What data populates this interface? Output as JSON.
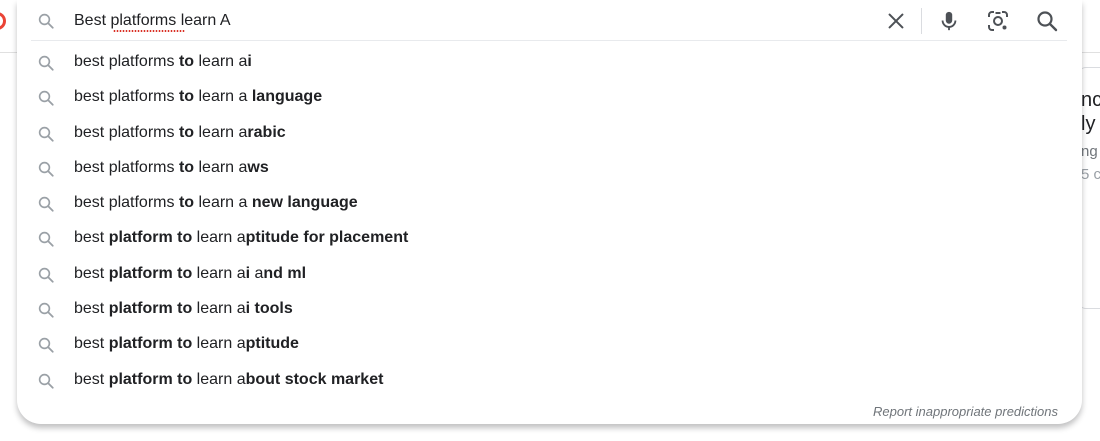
{
  "search": {
    "query": "Best platforms learn A",
    "clear_label": "Clear",
    "voice_label": "Search by voice",
    "lens_label": "Search by image",
    "submit_label": "Search"
  },
  "suggestions": [
    {
      "segments": [
        {
          "t": "best platforms ",
          "b": false
        },
        {
          "t": "to",
          "b": true
        },
        {
          "t": " learn a",
          "b": false
        },
        {
          "t": "i",
          "b": true
        }
      ]
    },
    {
      "segments": [
        {
          "t": "best platforms ",
          "b": false
        },
        {
          "t": "to",
          "b": true
        },
        {
          "t": " learn a ",
          "b": false
        },
        {
          "t": "language",
          "b": true
        }
      ]
    },
    {
      "segments": [
        {
          "t": "best platforms ",
          "b": false
        },
        {
          "t": "to",
          "b": true
        },
        {
          "t": " learn a",
          "b": false
        },
        {
          "t": "rabic",
          "b": true
        }
      ]
    },
    {
      "segments": [
        {
          "t": "best platforms ",
          "b": false
        },
        {
          "t": "to",
          "b": true
        },
        {
          "t": " learn a",
          "b": false
        },
        {
          "t": "ws",
          "b": true
        }
      ]
    },
    {
      "segments": [
        {
          "t": "best platforms ",
          "b": false
        },
        {
          "t": "to",
          "b": true
        },
        {
          "t": " learn a ",
          "b": false
        },
        {
          "t": "new language",
          "b": true
        }
      ]
    },
    {
      "segments": [
        {
          "t": "best ",
          "b": false
        },
        {
          "t": "platform to",
          "b": true
        },
        {
          "t": " learn a",
          "b": false
        },
        {
          "t": "ptitude for placement",
          "b": true
        }
      ]
    },
    {
      "segments": [
        {
          "t": "best ",
          "b": false
        },
        {
          "t": "platform to",
          "b": true
        },
        {
          "t": " learn a",
          "b": false
        },
        {
          "t": "i",
          "b": true
        },
        {
          "t": " a",
          "b": false
        },
        {
          "t": "nd ml",
          "b": true
        }
      ]
    },
    {
      "segments": [
        {
          "t": "best ",
          "b": false
        },
        {
          "t": "platform to",
          "b": true
        },
        {
          "t": " learn a",
          "b": false
        },
        {
          "t": "i tools",
          "b": true
        }
      ]
    },
    {
      "segments": [
        {
          "t": "best ",
          "b": false
        },
        {
          "t": "platform to",
          "b": true
        },
        {
          "t": " learn a",
          "b": false
        },
        {
          "t": "ptitude",
          "b": true
        }
      ]
    },
    {
      "segments": [
        {
          "t": "best ",
          "b": false
        },
        {
          "t": "platform to",
          "b": true
        },
        {
          "t": " learn a",
          "b": false
        },
        {
          "t": "bout stock market",
          "b": true
        }
      ]
    }
  ],
  "report_link": "Report inappropriate predictions",
  "background_card": {
    "line1": "nc",
    "line2": "ly",
    "line3": "ng",
    "line4": "5 c"
  },
  "icons": {
    "suggestion": "search-icon",
    "clear": "close-icon",
    "voice": "microphone-icon",
    "lens": "camera-lens-icon",
    "submit": "search-icon"
  },
  "colors": {
    "text": "#202124",
    "muted": "#70757a",
    "icon": "#9aa0a6",
    "action_icon": "#4d5156",
    "spelling": "#d93025",
    "logo_red": "#ea4335"
  }
}
